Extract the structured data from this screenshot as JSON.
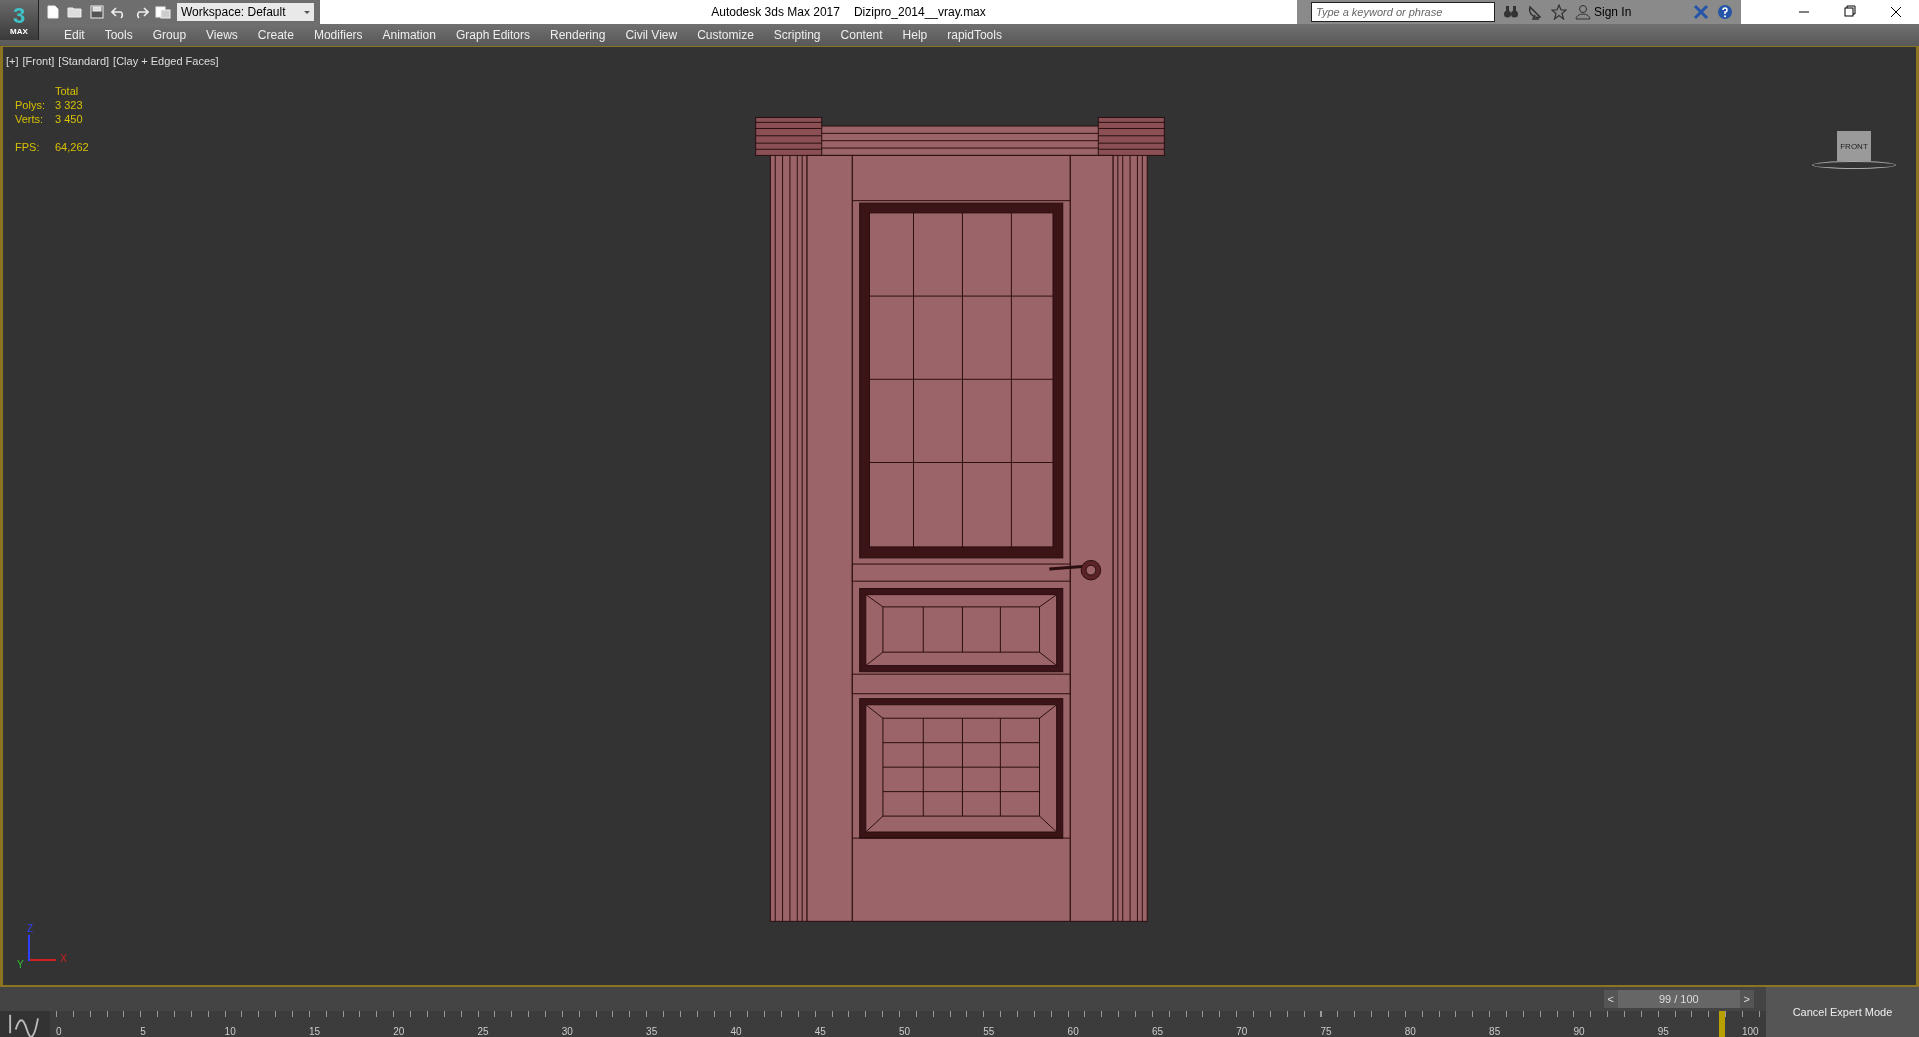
{
  "app_button": {
    "glyph": "3",
    "label": "MAX"
  },
  "workspace": {
    "value": "Workspace: Default"
  },
  "window_title": "Autodesk 3ds Max 2017",
  "file_name": "Dizipro_2014__vray.max",
  "search": {
    "placeholder": "Type a keyword or phrase"
  },
  "sign_in": "Sign In",
  "menu": [
    "Edit",
    "Tools",
    "Group",
    "Views",
    "Create",
    "Modifiers",
    "Animation",
    "Graph Editors",
    "Rendering",
    "Civil View",
    "Customize",
    "Scripting",
    "Content",
    "Help",
    "rapidTools"
  ],
  "viewport": {
    "labels": [
      "[+]",
      "[Front]",
      "[Standard]",
      "[Clay + Edged Faces]"
    ],
    "stats": {
      "header": "Total",
      "rows": [
        {
          "label": "Polys:",
          "value": "3 323"
        },
        {
          "label": "Verts:",
          "value": "3 450"
        }
      ],
      "fps": {
        "label": "FPS:",
        "value": "64,262"
      }
    },
    "viewcube": "FRONT",
    "axes": [
      "Z",
      "Y",
      "X"
    ]
  },
  "time_slider": {
    "prev": "<",
    "frame": "99 / 100",
    "next": ">",
    "level": 0.99
  },
  "ruler": {
    "ticks": [
      "0",
      "5",
      "10",
      "15",
      "20",
      "25",
      "30",
      "35",
      "40",
      "45",
      "50",
      "55",
      "60",
      "65",
      "70",
      "75",
      "80",
      "85",
      "90",
      "95",
      "100"
    ]
  },
  "cancel_expert": "Cancel Expert Mode"
}
